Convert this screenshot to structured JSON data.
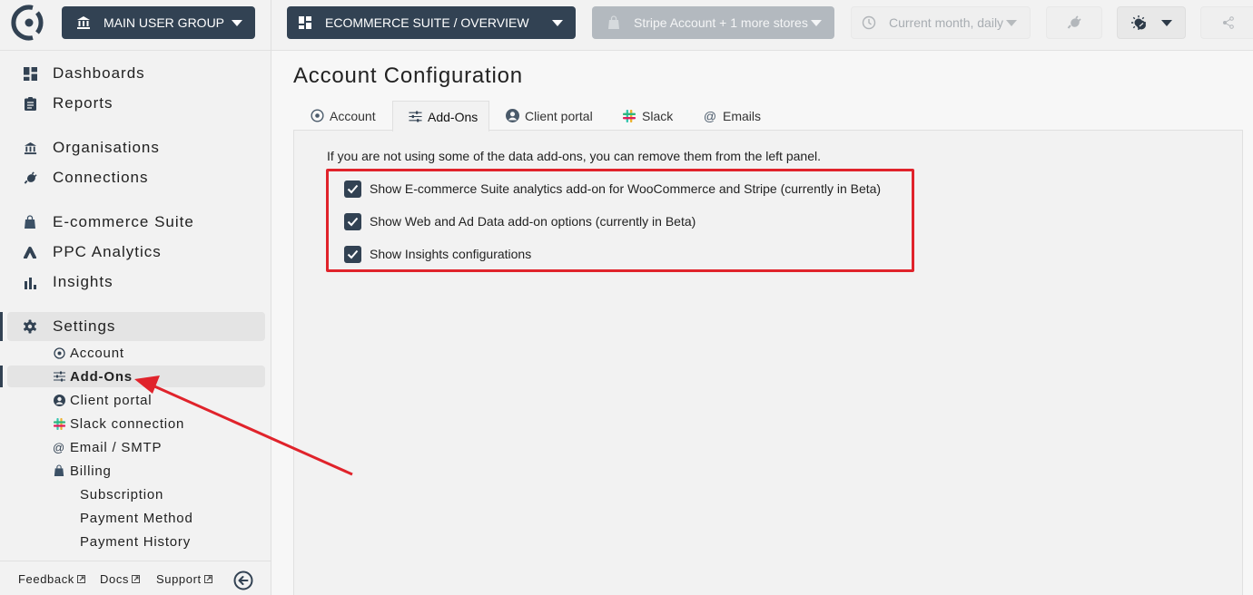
{
  "topbar": {
    "logo": "app-logo",
    "group_selector": {
      "label": "MAIN USER GROUP",
      "icon": "bank-icon"
    },
    "dashboard_selector": {
      "label": "ECOMMERCE SUITE / OVERVIEW",
      "icon": "dashboard-icon"
    },
    "store_selector": {
      "label": "Stripe Account + 1 more stores",
      "icon": "shopping-bag-icon",
      "state": "disabled"
    },
    "date_selector": {
      "label": "Current month, daily",
      "icon": "clock-icon",
      "state": "disabled"
    },
    "connection_button": {
      "icon": "plug-icon"
    },
    "theme_button": {
      "icon": "theme-toggle-icon"
    },
    "share_button": {
      "icon": "share-icon"
    }
  },
  "sidebar": {
    "items": [
      {
        "label": "Dashboards",
        "icon": "dashboard-icon"
      },
      {
        "label": "Reports",
        "icon": "clipboard-icon"
      },
      {
        "label": "Organisations",
        "icon": "bank-icon"
      },
      {
        "label": "Connections",
        "icon": "plug-icon"
      },
      {
        "label": "E-commerce Suite",
        "icon": "shopping-bag-icon"
      },
      {
        "label": "PPC Analytics",
        "icon": "google-ads-icon"
      },
      {
        "label": "Insights",
        "icon": "bar-chart-icon"
      },
      {
        "label": "Settings",
        "icon": "gear-icon",
        "active": true
      }
    ],
    "settings_sub": [
      {
        "label": "Account",
        "icon": "target-icon"
      },
      {
        "label": "Add-Ons",
        "icon": "sliders-icon",
        "active": true
      },
      {
        "label": "Client portal",
        "icon": "user-circle-icon"
      },
      {
        "label": "Slack connection",
        "icon": "slack-icon"
      },
      {
        "label": "Email / SMTP",
        "icon": "at-icon"
      },
      {
        "label": "Billing",
        "icon": "shopping-bag-icon"
      }
    ],
    "billing_sub": [
      {
        "label": "Subscription"
      },
      {
        "label": "Payment Method"
      },
      {
        "label": "Payment History"
      }
    ],
    "footer": {
      "feedback": "Feedback",
      "docs": "Docs",
      "support": "Support",
      "collapse_icon": "arrow-left-circle-icon"
    }
  },
  "main": {
    "title": "Account Configuration",
    "tabs": [
      {
        "label": "Account",
        "icon": "target-icon"
      },
      {
        "label": "Add-Ons",
        "icon": "sliders-icon",
        "active": true
      },
      {
        "label": "Client portal",
        "icon": "user-circle-icon"
      },
      {
        "label": "Slack",
        "icon": "slack-icon"
      },
      {
        "label": "Emails",
        "icon": "at-icon"
      }
    ],
    "info_text": "If you are not using some of the data add-ons, you can remove them from the left panel.",
    "options": [
      {
        "label": "Show E-commerce Suite analytics add-on for WooCommerce and Stripe (currently in Beta)",
        "checked": true
      },
      {
        "label": "Show Web and Ad Data add-on options (currently in Beta)",
        "checked": true
      },
      {
        "label": "Show Insights configurations",
        "checked": true
      }
    ]
  },
  "annotation": {
    "highlight_color": "#e0232b"
  },
  "colors": {
    "primary": "#324253",
    "background": "#f2f2f2",
    "accent_red": "#e0232b"
  }
}
